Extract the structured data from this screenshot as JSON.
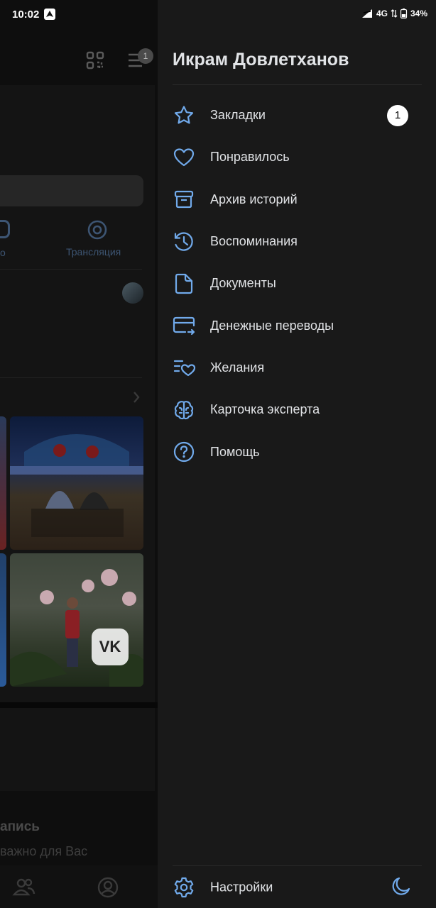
{
  "status_bar": {
    "time": "10:02",
    "network": "4G",
    "battery": "34%"
  },
  "background": {
    "menu_badge": "1",
    "tab_partial_label": "о",
    "broadcast_label": "Трансляция",
    "post_title_partial": "апись",
    "post_subtitle_partial": "важно для Вас"
  },
  "drawer": {
    "title": "Икрам Довлетханов",
    "items": [
      {
        "icon": "star-icon",
        "label": "Закладки",
        "counter": "1"
      },
      {
        "icon": "heart-icon",
        "label": "Понравилось"
      },
      {
        "icon": "archive-icon",
        "label": "Архив историй"
      },
      {
        "icon": "history-clock-icon",
        "label": "Воспоминания"
      },
      {
        "icon": "document-icon",
        "label": "Документы"
      },
      {
        "icon": "card-transfer-icon",
        "label": "Денежные переводы"
      },
      {
        "icon": "wishlist-icon",
        "label": "Желания"
      },
      {
        "icon": "brain-icon",
        "label": "Карточка эксперта"
      },
      {
        "icon": "help-icon",
        "label": "Помощь"
      }
    ],
    "settings_label": "Настройки",
    "accent_color": "#71aaeb"
  }
}
